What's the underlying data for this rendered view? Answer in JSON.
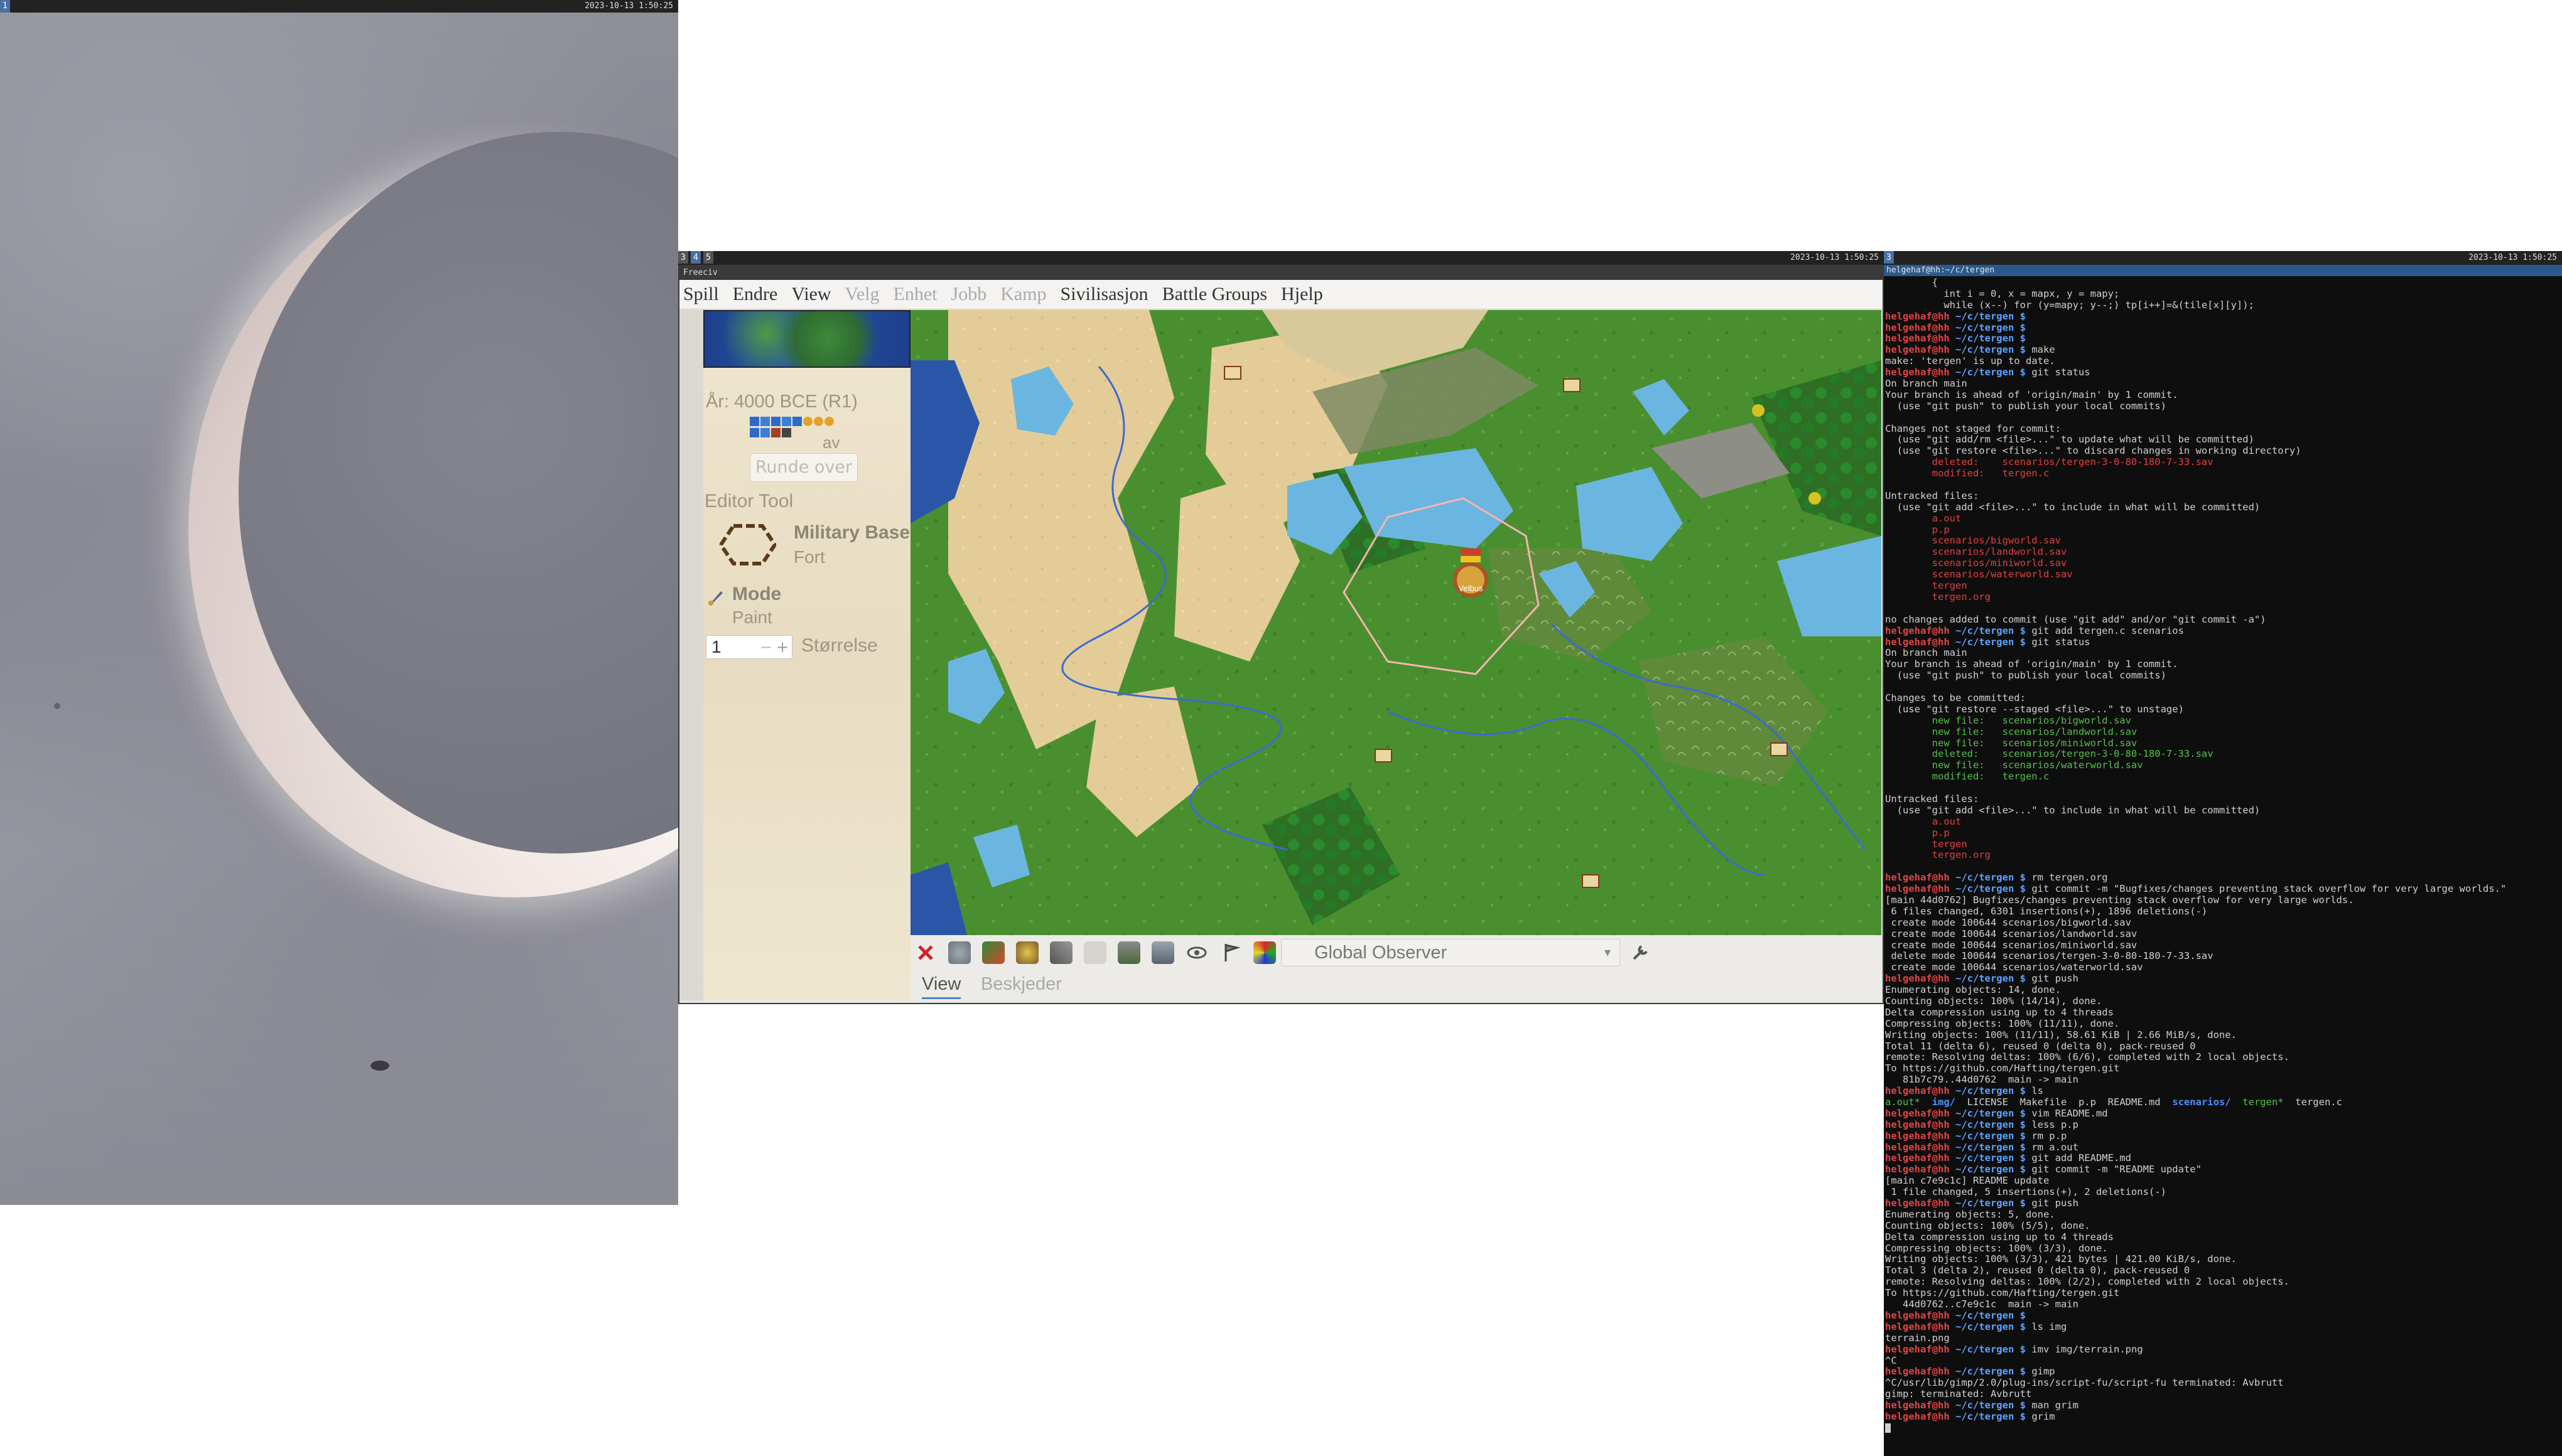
{
  "left_monitor": {
    "bar": {
      "workspace": "1",
      "clock": "2023-10-13  1:50:25"
    }
  },
  "middle_monitor": {
    "bar": {
      "workspaces": [
        "3",
        "4",
        "5"
      ],
      "clock": "2023-10-13  1:50:25"
    },
    "window_title": "Freeciv",
    "menu": [
      {
        "label": "Spill",
        "enabled": true
      },
      {
        "label": "Endre",
        "enabled": true
      },
      {
        "label": "View",
        "enabled": true
      },
      {
        "label": "Velg",
        "enabled": false
      },
      {
        "label": "Enhet",
        "enabled": false
      },
      {
        "label": "Jobb",
        "enabled": false
      },
      {
        "label": "Kamp",
        "enabled": false
      },
      {
        "label": "Sivilisasjon",
        "enabled": true
      },
      {
        "label": "Battle Groups",
        "enabled": true
      },
      {
        "label": "Hjelp",
        "enabled": true
      }
    ],
    "panel": {
      "year": "År: 4000 BCE (R1)",
      "av": "av",
      "turn_done": "Runde over",
      "editor_tool": "Editor Tool",
      "military_base": "Military Base",
      "fort": "Fort",
      "mode": "Mode",
      "paint": "Paint",
      "size_value": "1",
      "size_label": "Størrelse"
    },
    "map": {
      "city_label": "Velbus",
      "colors": {
        "grass": "#4a8f2f",
        "desert": "#e6cf9e",
        "water": "#6bb6e0",
        "ocean": "#2a56a8",
        "border": "#f3b6b0"
      }
    },
    "toolbar": {
      "icons": [
        "close-icon",
        "editor-icon",
        "paint-icon",
        "helmet-icon",
        "tools-icon",
        "shield-icon",
        "catapult-icon",
        "observer-ship-icon",
        "eye-icon",
        "flag-icon",
        "palette-icon"
      ],
      "player_select": "Global Observer",
      "settings_icon": "wrench-icon"
    },
    "tabs": [
      "View",
      "Beskjeder"
    ]
  },
  "right_monitor": {
    "bar": {
      "workspace": "3",
      "clock": "2023-10-13  1:50:25"
    },
    "title": "helgehaf@hh:~/c/tergen",
    "prompt_user": "helgehaf@hh",
    "prompt_path": " ~/c/tergen $ ",
    "lines": [
      {
        "t": "o",
        "s": "        {"
      },
      {
        "t": "o",
        "s": "          int i = 0, x = mapx, y = mapy;"
      },
      {
        "t": "o",
        "s": "          while (x--) for (y=mapy; y--;) tp[i++]=&(tile[x][y]);"
      },
      {
        "t": "p",
        "s": ""
      },
      {
        "t": "p",
        "s": ""
      },
      {
        "t": "p",
        "s": ""
      },
      {
        "t": "p",
        "s": "make"
      },
      {
        "t": "o",
        "s": "make: 'tergen' is up to date."
      },
      {
        "t": "p",
        "s": "git status"
      },
      {
        "t": "o",
        "s": "On branch main"
      },
      {
        "t": "o",
        "s": "Your branch is ahead of 'origin/main' by 1 commit."
      },
      {
        "t": "o",
        "s": "  (use \"git push\" to publish your local commits)"
      },
      {
        "t": "o",
        "s": ""
      },
      {
        "t": "o",
        "s": "Changes not staged for commit:"
      },
      {
        "t": "o",
        "s": "  (use \"git add/rm <file>...\" to update what will be committed)"
      },
      {
        "t": "o",
        "s": "  (use \"git restore <file>...\" to discard changes in working directory)"
      },
      {
        "t": "r",
        "s": "        deleted:    scenarios/tergen-3-0-80-180-7-33.sav"
      },
      {
        "t": "r",
        "s": "        modified:   tergen.c"
      },
      {
        "t": "o",
        "s": ""
      },
      {
        "t": "o",
        "s": "Untracked files:"
      },
      {
        "t": "o",
        "s": "  (use \"git add <file>...\" to include in what will be committed)"
      },
      {
        "t": "r",
        "s": "        a.out"
      },
      {
        "t": "r",
        "s": "        p.p"
      },
      {
        "t": "r",
        "s": "        scenarios/bigworld.sav"
      },
      {
        "t": "r",
        "s": "        scenarios/landworld.sav"
      },
      {
        "t": "r",
        "s": "        scenarios/miniworld.sav"
      },
      {
        "t": "r",
        "s": "        scenarios/waterworld.sav"
      },
      {
        "t": "r",
        "s": "        tergen"
      },
      {
        "t": "r",
        "s": "        tergen.org"
      },
      {
        "t": "o",
        "s": ""
      },
      {
        "t": "o",
        "s": "no changes added to commit (use \"git add\" and/or \"git commit -a\")"
      },
      {
        "t": "p",
        "s": "git add tergen.c scenarios"
      },
      {
        "t": "p",
        "s": "git status"
      },
      {
        "t": "o",
        "s": "On branch main"
      },
      {
        "t": "o",
        "s": "Your branch is ahead of 'origin/main' by 1 commit."
      },
      {
        "t": "o",
        "s": "  (use \"git push\" to publish your local commits)"
      },
      {
        "t": "o",
        "s": ""
      },
      {
        "t": "o",
        "s": "Changes to be committed:"
      },
      {
        "t": "o",
        "s": "  (use \"git restore --staged <file>...\" to unstage)"
      },
      {
        "t": "g",
        "s": "        new file:   scenarios/bigworld.sav"
      },
      {
        "t": "g",
        "s": "        new file:   scenarios/landworld.sav"
      },
      {
        "t": "g",
        "s": "        new file:   scenarios/miniworld.sav"
      },
      {
        "t": "g",
        "s": "        deleted:    scenarios/tergen-3-0-80-180-7-33.sav"
      },
      {
        "t": "g",
        "s": "        new file:   scenarios/waterworld.sav"
      },
      {
        "t": "g",
        "s": "        modified:   tergen.c"
      },
      {
        "t": "o",
        "s": ""
      },
      {
        "t": "o",
        "s": "Untracked files:"
      },
      {
        "t": "o",
        "s": "  (use \"git add <file>...\" to include in what will be committed)"
      },
      {
        "t": "r",
        "s": "        a.out"
      },
      {
        "t": "r",
        "s": "        p.p"
      },
      {
        "t": "r",
        "s": "        tergen"
      },
      {
        "t": "r",
        "s": "        tergen.org"
      },
      {
        "t": "o",
        "s": ""
      },
      {
        "t": "p",
        "s": "rm tergen.org"
      },
      {
        "t": "p",
        "s": "git commit -m \"Bugfixes/changes preventing stack overflow for very large worlds.\""
      },
      {
        "t": "o",
        "s": "[main 44d0762] Bugfixes/changes preventing stack overflow for very large worlds."
      },
      {
        "t": "o",
        "s": " 6 files changed, 6301 insertions(+), 1896 deletions(-)"
      },
      {
        "t": "o",
        "s": " create mode 100644 scenarios/bigworld.sav"
      },
      {
        "t": "o",
        "s": " create mode 100644 scenarios/landworld.sav"
      },
      {
        "t": "o",
        "s": " create mode 100644 scenarios/miniworld.sav"
      },
      {
        "t": "o",
        "s": " delete mode 100644 scenarios/tergen-3-0-80-180-7-33.sav"
      },
      {
        "t": "o",
        "s": " create mode 100644 scenarios/waterworld.sav"
      },
      {
        "t": "p",
        "s": "git push"
      },
      {
        "t": "o",
        "s": "Enumerating objects: 14, done."
      },
      {
        "t": "o",
        "s": "Counting objects: 100% (14/14), done."
      },
      {
        "t": "o",
        "s": "Delta compression using up to 4 threads"
      },
      {
        "t": "o",
        "s": "Compressing objects: 100% (11/11), done."
      },
      {
        "t": "o",
        "s": "Writing objects: 100% (11/11), 58.61 KiB | 2.66 MiB/s, done."
      },
      {
        "t": "o",
        "s": "Total 11 (delta 6), reused 0 (delta 0), pack-reused 0"
      },
      {
        "t": "o",
        "s": "remote: Resolving deltas: 100% (6/6), completed with 2 local objects."
      },
      {
        "t": "o",
        "s": "To https://github.com/Hafting/tergen.git"
      },
      {
        "t": "o",
        "s": "   81b7c79..44d0762  main -> main"
      },
      {
        "t": "p",
        "s": "ls"
      },
      {
        "t": "ls",
        "s": ""
      },
      {
        "t": "p",
        "s": "vim README.md"
      },
      {
        "t": "p",
        "s": "less p.p"
      },
      {
        "t": "p",
        "s": "rm p.p"
      },
      {
        "t": "p",
        "s": "rm a.out"
      },
      {
        "t": "p",
        "s": "git add README.md"
      },
      {
        "t": "p",
        "s": "git commit -m \"README update\""
      },
      {
        "t": "o",
        "s": "[main c7e9c1c] README update"
      },
      {
        "t": "o",
        "s": " 1 file changed, 5 insertions(+), 2 deletions(-)"
      },
      {
        "t": "p",
        "s": "git push"
      },
      {
        "t": "o",
        "s": "Enumerating objects: 5, done."
      },
      {
        "t": "o",
        "s": "Counting objects: 100% (5/5), done."
      },
      {
        "t": "o",
        "s": "Delta compression using up to 4 threads"
      },
      {
        "t": "o",
        "s": "Compressing objects: 100% (3/3), done."
      },
      {
        "t": "o",
        "s": "Writing objects: 100% (3/3), 421 bytes | 421.00 KiB/s, done."
      },
      {
        "t": "o",
        "s": "Total 3 (delta 2), reused 0 (delta 0), pack-reused 0"
      },
      {
        "t": "o",
        "s": "remote: Resolving deltas: 100% (2/2), completed with 2 local objects."
      },
      {
        "t": "o",
        "s": "To https://github.com/Hafting/tergen.git"
      },
      {
        "t": "o",
        "s": "   44d0762..c7e9c1c  main -> main"
      },
      {
        "t": "p",
        "s": ""
      },
      {
        "t": "p",
        "s": "ls img"
      },
      {
        "t": "o",
        "s": "terrain.png"
      },
      {
        "t": "p",
        "s": "imv img/terrain.png"
      },
      {
        "t": "o",
        "s": "^C"
      },
      {
        "t": "p",
        "s": "gimp"
      },
      {
        "t": "o",
        "s": "^C/usr/lib/gimp/2.0/plug-ins/script-fu/script-fu terminated: Avbrutt"
      },
      {
        "t": "o",
        "s": "gimp: terminated: Avbrutt"
      },
      {
        "t": "p",
        "s": "man grim"
      },
      {
        "t": "p",
        "s": "grim"
      },
      {
        "t": "cur",
        "s": ""
      }
    ],
    "ls_output": [
      {
        "name": "a.out*",
        "cls": "c-green"
      },
      {
        "name": "img/",
        "cls": "c-blue"
      },
      {
        "name": "LICENSE",
        "cls": ""
      },
      {
        "name": "Makefile",
        "cls": ""
      },
      {
        "name": "p.p",
        "cls": ""
      },
      {
        "name": "README.md",
        "cls": ""
      },
      {
        "name": "scenarios/",
        "cls": "c-blue"
      },
      {
        "name": "tergen*",
        "cls": "c-green"
      },
      {
        "name": "tergen.c",
        "cls": ""
      }
    ]
  }
}
